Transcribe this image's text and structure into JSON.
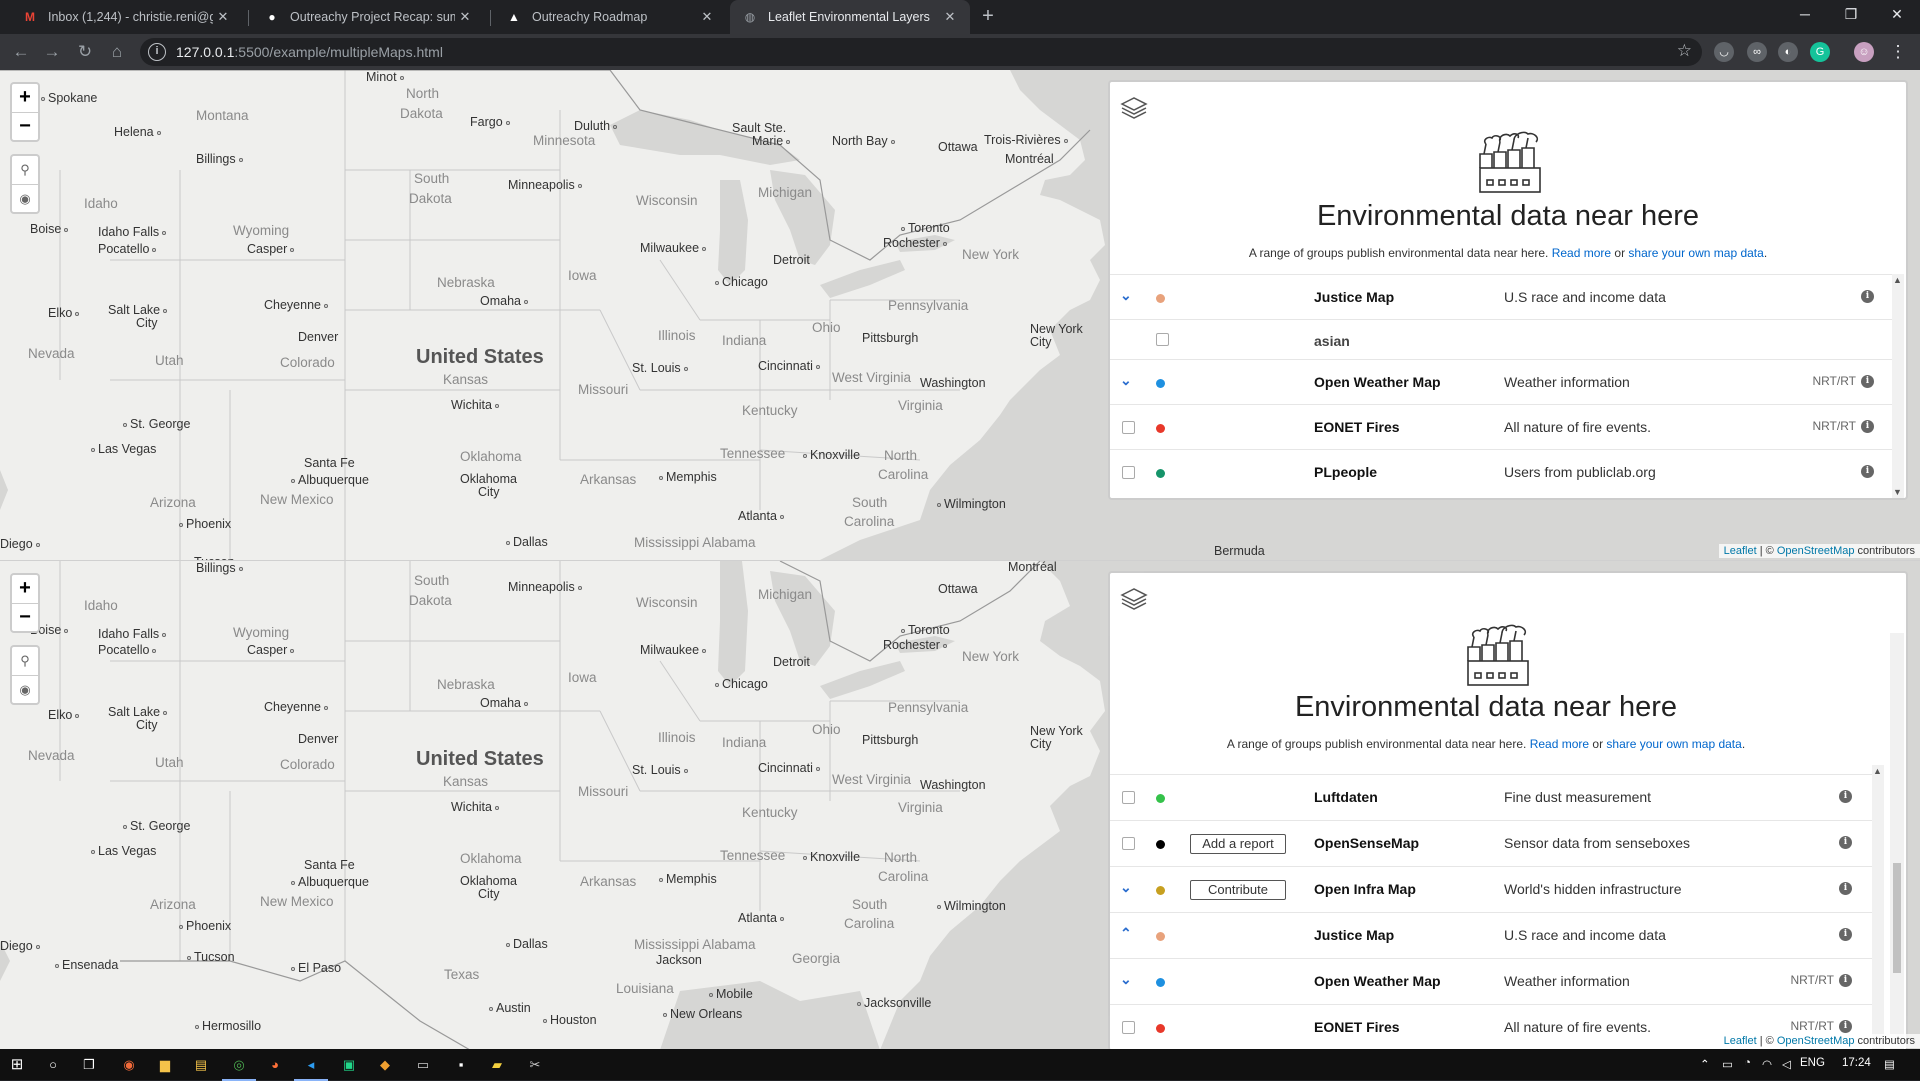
{
  "browser": {
    "tabs": [
      {
        "title": "Inbox (1,244) - christie.reni@gma",
        "icon": "gmail-icon",
        "active": false
      },
      {
        "title": "Outreachy Project Recap: summa",
        "icon": "github-icon",
        "active": false
      },
      {
        "title": "Outreachy Roadmap",
        "icon": "triangle-icon",
        "active": false
      },
      {
        "title": "Leaflet Environmental Layers",
        "icon": "globe-icon",
        "active": true
      }
    ],
    "url_host": "127.0.0.1",
    "url_rest": ":5500/example/multipleMaps.html"
  },
  "map": {
    "country": "United States",
    "top_attribution": {
      "leaflet": "Leaflet",
      "sep": " | © ",
      "osm": "OpenStreetMap",
      "tail": " contributors"
    },
    "bottom_attribution": {
      "leaflet": "Leaflet",
      "sep": " | © ",
      "osm": "OpenStreetMap",
      "tail": " contributors"
    },
    "zoom_in": "+",
    "zoom_out": "−"
  },
  "panel": {
    "title": "Environmental data near here",
    "subtitle_prefix": "A range of groups publish environmental data near here. ",
    "read_more": "Read more",
    "or": " or ",
    "share": "share your own map data",
    "period": "."
  },
  "panel_top_rows": [
    {
      "control": "chevron-down",
      "color": "#e8a27c",
      "name": "Justice Map",
      "desc": "U.S race and income data",
      "nrt": ""
    },
    {
      "control": "checkbox-sub",
      "name": "asian"
    },
    {
      "control": "chevron-down",
      "color": "#1e90e0",
      "name": "Open Weather Map",
      "desc": "Weather information",
      "nrt": "NRT/RT"
    },
    {
      "control": "checkbox",
      "color": "#e8382a",
      "name": "EONET Fires",
      "desc": "All nature of fire events.",
      "nrt": "NRT/RT"
    },
    {
      "control": "checkbox",
      "color": "#16946a",
      "name": "PLpeople",
      "desc": "Users from publiclab.org",
      "nrt": ""
    }
  ],
  "panel_bottom_rows": [
    {
      "control": "checkbox",
      "color": "#35c24a",
      "name": "Luftdaten",
      "desc": "Fine dust measurement",
      "nrt": "",
      "button": ""
    },
    {
      "control": "checkbox",
      "color": "#000000",
      "name": "OpenSenseMap",
      "desc": "Sensor data from senseboxes",
      "nrt": "",
      "button": "Add a report"
    },
    {
      "control": "chevron-down",
      "color": "#c7a020",
      "name": "Open Infra Map",
      "desc": "World's hidden infrastructure",
      "nrt": "",
      "button": "Contribute"
    },
    {
      "control": "chevron-up",
      "color": "#e8a27c",
      "name": "Justice Map",
      "desc": "U.S race and income data",
      "nrt": "",
      "button": ""
    },
    {
      "control": "chevron-down",
      "color": "#1e90e0",
      "name": "Open Weather Map",
      "desc": "Weather information",
      "nrt": "NRT/RT",
      "button": ""
    },
    {
      "control": "checkbox",
      "color": "#e8382a",
      "name": "EONET Fires",
      "desc": "All nature of fire events.",
      "nrt": "NRT/RT",
      "button": ""
    }
  ],
  "taskbar": {
    "lang": "ENG",
    "time": "17:24"
  }
}
